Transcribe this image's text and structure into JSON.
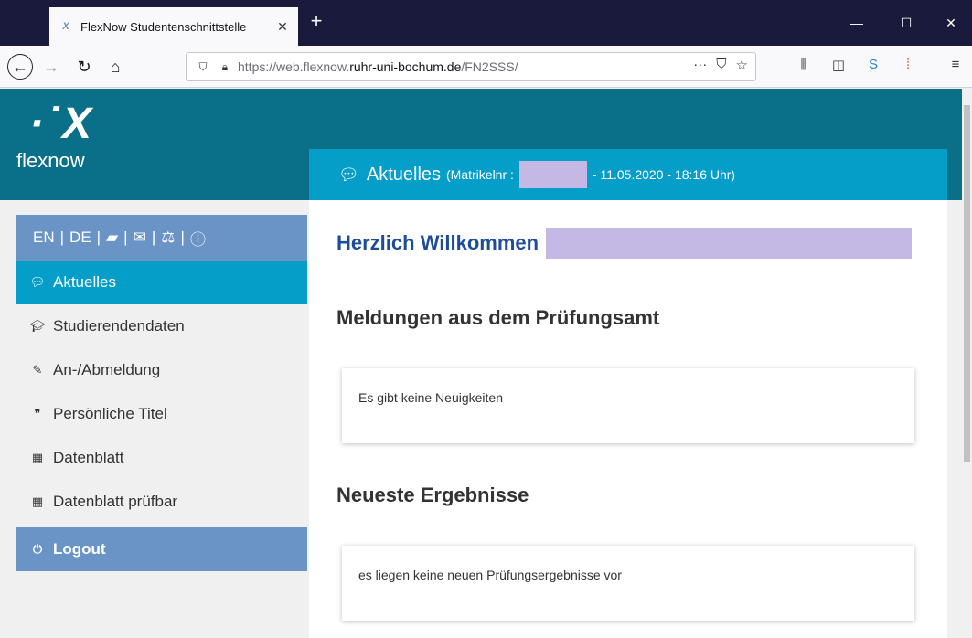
{
  "browser": {
    "tab_title": "FlexNow Studentenschnittstelle",
    "tab_close": "✕",
    "new_tab": "+",
    "url_prefix": "https://web.flexnow.",
    "url_host": "ruhr-uni-bochum.de",
    "url_path": "/FN2SSS/",
    "window_minimize": "—",
    "window_maximize": "☐",
    "window_close": "✕"
  },
  "logo": {
    "mark": "·˙X",
    "text": "flexnow"
  },
  "sidebar": {
    "lang_en": "EN",
    "lang_de": "DE",
    "separator": "|",
    "items": [
      {
        "label": "Aktuelles",
        "icon": "💬"
      },
      {
        "label": "Studierendendaten",
        "icon": "🎓"
      },
      {
        "label": "An-/Abmeldung",
        "icon": "✎"
      },
      {
        "label": "Persönliche Titel",
        "icon": "❞"
      },
      {
        "label": "Datenblatt",
        "icon": "▦"
      },
      {
        "label": "Datenblatt prüfbar",
        "icon": "▦"
      }
    ],
    "logout": {
      "label": "Logout",
      "icon": "⏻"
    }
  },
  "content": {
    "header_title": "Aktuelles",
    "header_matrikel_label": "(Matrikelnr :",
    "header_datetime": "- 11.05.2020 - 18:16 Uhr)",
    "welcome": "Herzlich Willkommen",
    "section_messages": "Meldungen aus dem Prüfungsamt",
    "messages_empty": "Es gibt keine Neuigkeiten",
    "section_results": "Neueste Ergebnisse",
    "results_empty": "es liegen keine neuen Prüfungsergebnisse vor"
  },
  "colors": {
    "header_band": "#0a6f88",
    "accent": "#049ec9",
    "sidebar_bar": "#6a93c6",
    "welcome_text": "#1d4d9a",
    "redaction": "#c4b8e4"
  }
}
